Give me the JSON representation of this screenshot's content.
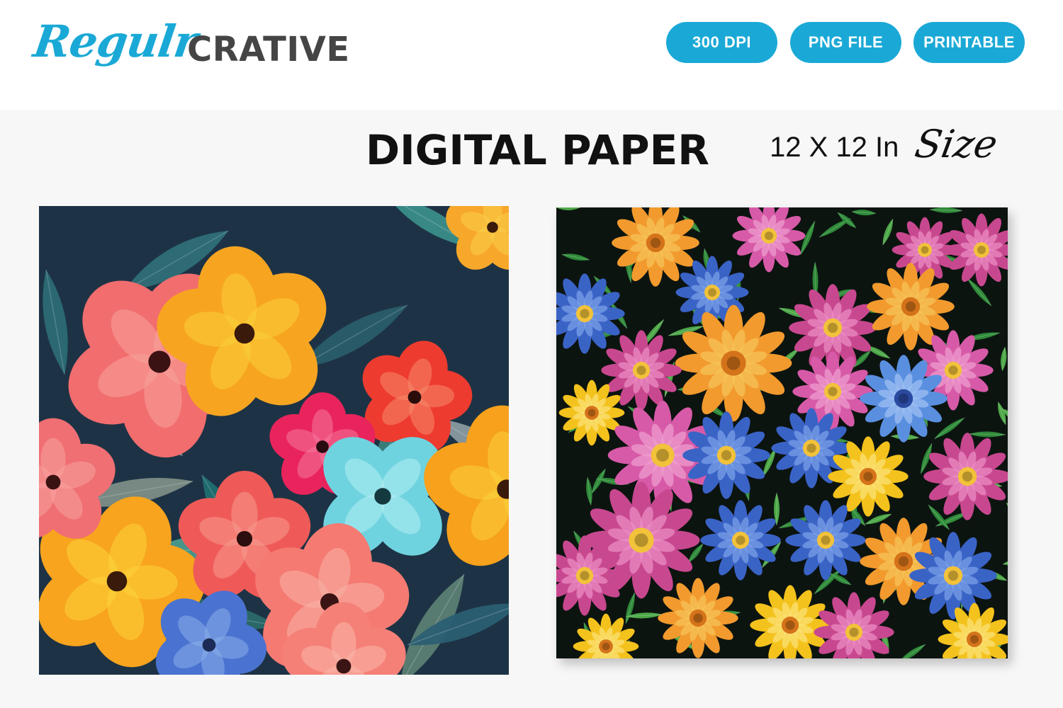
{
  "brand": {
    "script_part": "Regulr",
    "block_part": "CRATIVE",
    "script_color": "#1aa9d6",
    "block_color": "#454545"
  },
  "badges": [
    {
      "label": "300 DPI"
    },
    {
      "label": "PNG FILE"
    },
    {
      "label": "PRINTABLE"
    }
  ],
  "badge_color": "#1aa9d6",
  "heading": {
    "title": "DIGITAL PAPER",
    "size_text": "12 X 12 In",
    "size_script": "Size"
  },
  "papers": [
    {
      "name": "colorful-flowers-teal-background",
      "background": "#1d3345"
    },
    {
      "name": "colorful-daisies-black-background",
      "background": "#0c1410"
    }
  ]
}
